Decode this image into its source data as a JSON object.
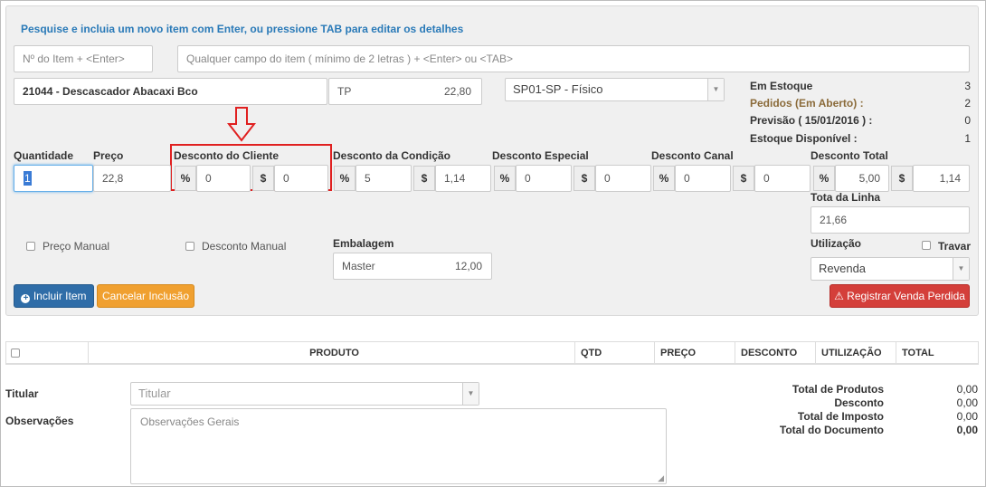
{
  "hint": "Pesquise e incluia um novo item com Enter, ou pressione TAB para editar os detalhes",
  "search": {
    "item_number_placeholder": "Nº do Item + <Enter>",
    "any_field_placeholder": "Qualquer campo do item ( mínimo de 2 letras ) + <Enter> ou <TAB>"
  },
  "item": {
    "name": "21044 - Descascador Abacaxi Bco",
    "price_table": "TP",
    "price_table_value": "22,80",
    "warehouse": "SP01-SP - Físico"
  },
  "stock": {
    "em_estoque_label": "Em Estoque",
    "em_estoque_value": "3",
    "pedidos_label": "Pedidos (Em Aberto) :",
    "pedidos_value": "2",
    "previsao_label": "Previsão ( 15/01/2016 ) :",
    "previsao_value": "0",
    "disponivel_label": "Estoque Disponível :",
    "disponivel_value": "1"
  },
  "fields": {
    "quantidade_label": "Quantidade",
    "quantidade_value": "1",
    "preco_label": "Preço",
    "preco_value": "22,8",
    "desc_cliente_label": "Desconto do Cliente",
    "desc_cliente_pct": "0",
    "desc_cliente_val": "0",
    "desc_condicao_label": "Desconto da Condição",
    "desc_condicao_pct": "5",
    "desc_condicao_val": "1,14",
    "desc_especial_label": "Desconto Especial",
    "desc_especial_pct": "0",
    "desc_especial_val": "0",
    "desc_canal_label": "Desconto Canal",
    "desc_canal_pct": "0",
    "desc_canal_val": "0",
    "desc_total_label": "Desconto Total",
    "desc_total_pct": "5,00",
    "desc_total_val": "1,14",
    "total_linha_label": "Tota da Linha",
    "total_linha_value": "21,66",
    "pct_symbol": "%",
    "dollar_symbol": "$"
  },
  "options": {
    "preco_manual": "Preço Manual",
    "desconto_manual": "Desconto Manual",
    "embalagem_label": "Embalagem",
    "embalagem_name": "Master",
    "embalagem_value": "12,00",
    "utilizacao_label": "Utilização",
    "utilizacao_value": "Revenda",
    "travar_label": "Travar"
  },
  "buttons": {
    "incluir": "Incluir Item",
    "cancelar": "Cancelar Inclusão",
    "registrar": "Registrar Venda Perdida"
  },
  "table": {
    "columns": [
      "PRODUTO",
      "QTD",
      "PREÇO",
      "DESCONTO",
      "UTILIZAÇÃO",
      "TOTAL"
    ]
  },
  "footer": {
    "titular_label": "Titular",
    "titular_placeholder": "Titular",
    "observacoes_label": "Observações",
    "observacoes_placeholder": "Observações Gerais",
    "total_produtos_label": "Total de Produtos",
    "total_produtos_value": "0,00",
    "desconto_label": "Desconto",
    "desconto_value": "0,00",
    "total_imposto_label": "Total de Imposto",
    "total_imposto_value": "0,00",
    "total_documento_label": "Total do Documento",
    "total_documento_value": "0,00"
  },
  "colors": {
    "hint_blue": "#2a7ab8",
    "primary_button": "#2f6da8",
    "warning_button": "#f0a030",
    "danger_button": "#d43f3a",
    "annotation_red": "#e02020"
  }
}
